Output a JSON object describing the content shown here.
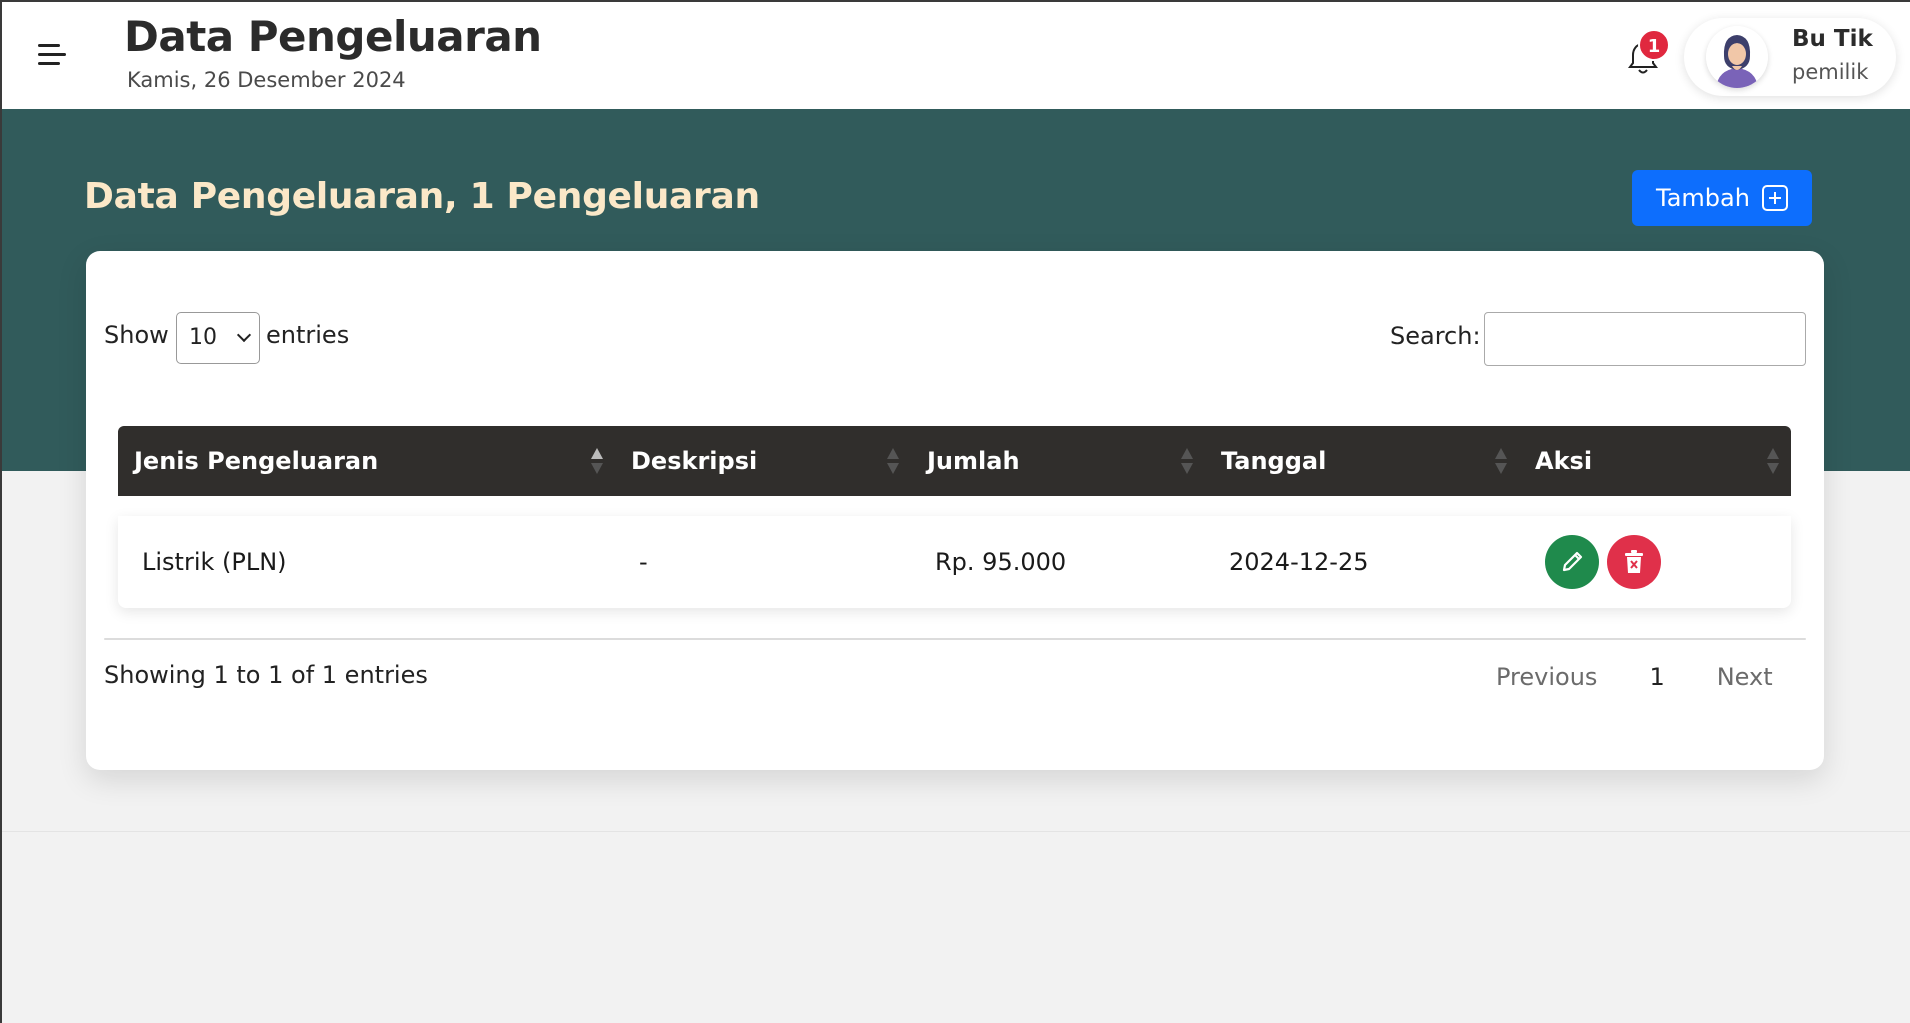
{
  "header": {
    "title": "Data Pengeluaran",
    "date": "Kamis, 26 Desember 2024",
    "notification_count": "1",
    "user": {
      "name": "Bu Tik",
      "role": "pemilik"
    }
  },
  "hero": {
    "title": "Data Pengeluaran, 1 Pengeluaran",
    "add_button_label": "Tambah"
  },
  "table_controls": {
    "show_label": "Show",
    "entries_value": "10",
    "entries_label": "entries",
    "search_label": "Search:",
    "search_value": ""
  },
  "table": {
    "columns": [
      "Jenis Pengeluaran",
      "Deskripsi",
      "Jumlah",
      "Tanggal",
      "Aksi"
    ],
    "rows": [
      {
        "jenis": "Listrik (PLN)",
        "deskripsi": "-",
        "jumlah": "Rp. 95.000",
        "tanggal": "2024-12-25"
      }
    ]
  },
  "footer": {
    "info": "Showing 1 to 1 of 1 entries",
    "previous": "Previous",
    "page": "1",
    "next": "Next"
  },
  "colors": {
    "hero_bg": "#315b5b",
    "hero_title": "#fbe8c8",
    "primary": "#0d6efd",
    "edit": "#1f8a4c",
    "delete": "#e0304a",
    "table_head": "#302e2c"
  }
}
